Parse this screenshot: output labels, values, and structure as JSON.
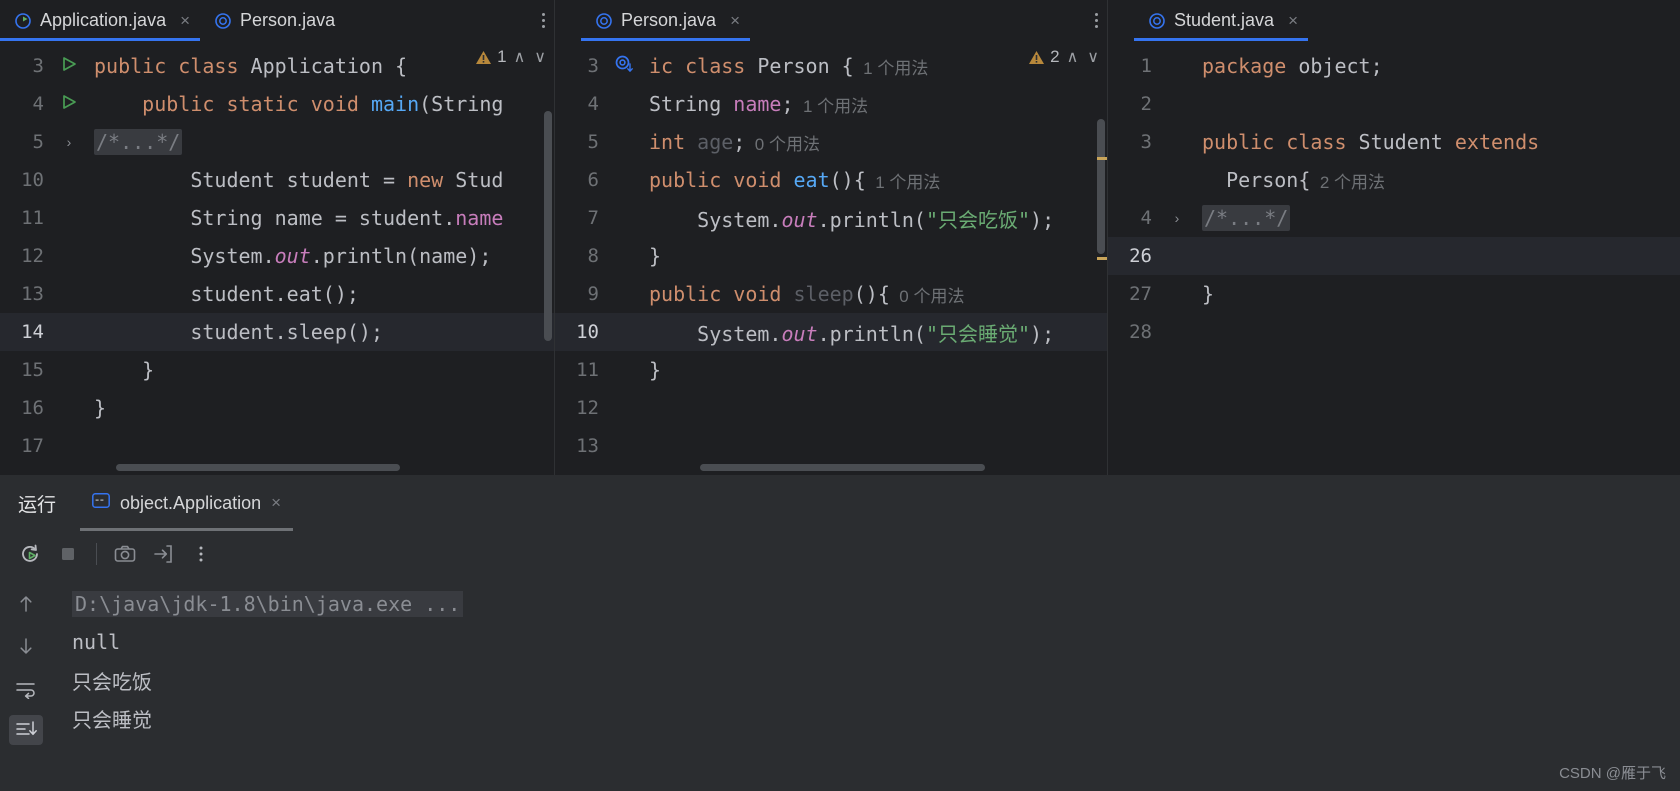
{
  "window": {
    "theme_bg": "#1e1f22",
    "panel_bg": "#2b2d30",
    "accent": "#3574f0"
  },
  "tab_groups": [
    {
      "name": "editor-group-1",
      "tabs": [
        {
          "label": "Application.java",
          "icon": "java-class-run-icon",
          "active": true,
          "close": "×"
        },
        {
          "label": "Person.java",
          "icon": "java-class-icon",
          "active": false,
          "close": ""
        }
      ],
      "overflow_icon": "more-options-icon"
    },
    {
      "name": "editor-group-2",
      "tabs": [
        {
          "label": "Person.java",
          "icon": "java-class-icon",
          "active": true,
          "close": "×"
        }
      ],
      "overflow_icon": "more-options-icon"
    },
    {
      "name": "editor-group-3",
      "tabs": [
        {
          "label": "Student.java",
          "icon": "java-class-icon",
          "active": true,
          "close": "×"
        }
      ],
      "overflow_icon": "more-options-icon"
    }
  ],
  "editor1": {
    "file": "Application.java",
    "inspection": {
      "warning_count": "1",
      "icon": "warning-triangle-icon",
      "up": "∧",
      "down": "∨"
    },
    "lines": [
      {
        "num": "3",
        "gutter": "run-class-icon",
        "current": false,
        "fold": "",
        "tokens": [
          {
            "t": "public ",
            "c": "kw"
          },
          {
            "t": "class ",
            "c": "kw"
          },
          {
            "t": "Application ",
            "c": "cls"
          },
          {
            "t": "{",
            "c": "plain"
          }
        ]
      },
      {
        "num": "4",
        "gutter": "run-method-icon",
        "current": false,
        "fold": "",
        "tokens": [
          {
            "t": "    public ",
            "c": "kw"
          },
          {
            "t": "static ",
            "c": "kw"
          },
          {
            "t": "void ",
            "c": "kw"
          },
          {
            "t": "main",
            "c": "meth"
          },
          {
            "t": "(String",
            "c": "plain"
          }
        ]
      },
      {
        "num": "5",
        "gutter": "",
        "current": false,
        "fold": "›",
        "tokens": [
          {
            "t": "/*...*/",
            "c": "fold"
          }
        ]
      },
      {
        "num": "10",
        "gutter": "",
        "current": false,
        "fold": "",
        "tokens": [
          {
            "t": "        Student student = ",
            "c": "plain"
          },
          {
            "t": "new ",
            "c": "kw"
          },
          {
            "t": "Stud",
            "c": "plain"
          }
        ]
      },
      {
        "num": "11",
        "gutter": "",
        "current": false,
        "fold": "",
        "tokens": [
          {
            "t": "        String name = student.",
            "c": "plain"
          },
          {
            "t": "name",
            "c": "fld"
          }
        ]
      },
      {
        "num": "12",
        "gutter": "",
        "current": false,
        "fold": "",
        "tokens": [
          {
            "t": "        System.",
            "c": "plain"
          },
          {
            "t": "out",
            "c": "stat"
          },
          {
            "t": ".println(name);",
            "c": "plain"
          }
        ]
      },
      {
        "num": "13",
        "gutter": "",
        "current": false,
        "fold": "",
        "tokens": [
          {
            "t": "        student.eat();",
            "c": "plain"
          }
        ]
      },
      {
        "num": "14",
        "gutter": "",
        "current": true,
        "fold": "",
        "tokens": [
          {
            "t": "        student.sleep();",
            "c": "plain"
          }
        ]
      },
      {
        "num": "15",
        "gutter": "",
        "current": false,
        "fold": "",
        "tokens": [
          {
            "t": "    }",
            "c": "plain"
          }
        ]
      },
      {
        "num": "16",
        "gutter": "",
        "current": false,
        "fold": "",
        "tokens": [
          {
            "t": "}",
            "c": "plain"
          }
        ]
      },
      {
        "num": "17",
        "gutter": "",
        "current": false,
        "fold": "",
        "tokens": []
      }
    ]
  },
  "editor2": {
    "file": "Person.java",
    "inspection": {
      "warning_count": "2",
      "icon": "warning-triangle-icon",
      "up": "∧",
      "down": "∨"
    },
    "lines": [
      {
        "num": "3",
        "gutter": "implemented-by-icon",
        "current": false,
        "fold": "",
        "tokens": [
          {
            "t": "ic ",
            "c": "kw"
          },
          {
            "t": "class ",
            "c": "kw"
          },
          {
            "t": "Person ",
            "c": "cls"
          },
          {
            "t": "{",
            "c": "plain"
          }
        ],
        "usage": "1 个用法"
      },
      {
        "num": "4",
        "gutter": "",
        "current": false,
        "fold": "",
        "tokens": [
          {
            "t": "String ",
            "c": "plain"
          },
          {
            "t": "name",
            "c": "fld"
          },
          {
            "t": ";",
            "c": "plain"
          }
        ],
        "usage": "1 个用法"
      },
      {
        "num": "5",
        "gutter": "",
        "current": false,
        "fold": "",
        "tokens": [
          {
            "t": "int ",
            "c": "kw"
          },
          {
            "t": "age",
            "c": "dim"
          },
          {
            "t": ";",
            "c": "plain"
          }
        ],
        "usage": "0 个用法"
      },
      {
        "num": "6",
        "gutter": "",
        "current": false,
        "fold": "",
        "tokens": [
          {
            "t": "public ",
            "c": "kw"
          },
          {
            "t": "void ",
            "c": "kw"
          },
          {
            "t": "eat",
            "c": "meth"
          },
          {
            "t": "(){",
            "c": "plain"
          }
        ],
        "usage": "1 个用法"
      },
      {
        "num": "7",
        "gutter": "",
        "current": false,
        "fold": "",
        "tokens": [
          {
            "t": "    System.",
            "c": "plain"
          },
          {
            "t": "out",
            "c": "stat"
          },
          {
            "t": ".println(",
            "c": "plain"
          },
          {
            "t": "\"只会吃饭\"",
            "c": "str"
          },
          {
            "t": ");",
            "c": "plain"
          }
        ],
        "usage": ""
      },
      {
        "num": "8",
        "gutter": "",
        "current": false,
        "fold": "",
        "tokens": [
          {
            "t": "}",
            "c": "plain"
          }
        ],
        "usage": ""
      },
      {
        "num": "9",
        "gutter": "",
        "current": false,
        "fold": "",
        "tokens": [
          {
            "t": "public ",
            "c": "kw"
          },
          {
            "t": "void ",
            "c": "kw"
          },
          {
            "t": "sleep",
            "c": "dim"
          },
          {
            "t": "(){",
            "c": "plain"
          }
        ],
        "usage": "0 个用法"
      },
      {
        "num": "10",
        "gutter": "",
        "current": true,
        "fold": "",
        "tokens": [
          {
            "t": "    System.",
            "c": "plain"
          },
          {
            "t": "out",
            "c": "stat"
          },
          {
            "t": ".println(",
            "c": "plain"
          },
          {
            "t": "\"只会睡觉\"",
            "c": "str"
          },
          {
            "t": ");",
            "c": "plain"
          }
        ],
        "usage": ""
      },
      {
        "num": "11",
        "gutter": "",
        "current": false,
        "fold": "",
        "tokens": [
          {
            "t": "}",
            "c": "plain"
          }
        ],
        "usage": ""
      },
      {
        "num": "12",
        "gutter": "",
        "current": false,
        "fold": "",
        "tokens": [],
        "usage": ""
      },
      {
        "num": "13",
        "gutter": "",
        "current": false,
        "fold": "",
        "tokens": [],
        "usage": ""
      }
    ]
  },
  "editor3": {
    "file": "Student.java",
    "lines": [
      {
        "num": "1",
        "gutter": "",
        "current": false,
        "fold": "",
        "tokens": [
          {
            "t": "package ",
            "c": "kw"
          },
          {
            "t": "object;",
            "c": "plain"
          }
        ],
        "usage": ""
      },
      {
        "num": "2",
        "gutter": "",
        "current": false,
        "fold": "",
        "tokens": [],
        "usage": ""
      },
      {
        "num": "3",
        "gutter": "",
        "current": false,
        "fold": "",
        "tokens": [
          {
            "t": "public ",
            "c": "kw"
          },
          {
            "t": "class ",
            "c": "kw"
          },
          {
            "t": "Student ",
            "c": "cls"
          },
          {
            "t": "extends",
            "c": "kw"
          }
        ],
        "usage": ""
      },
      {
        "num": "",
        "gutter": "",
        "current": false,
        "fold": "",
        "tokens": [
          {
            "t": "  Person{",
            "c": "plain"
          }
        ],
        "usage": "2 个用法"
      },
      {
        "num": "4",
        "gutter": "",
        "current": false,
        "fold": "›",
        "tokens": [
          {
            "t": "/*...*/",
            "c": "fold"
          }
        ],
        "usage": ""
      },
      {
        "num": "26",
        "gutter": "",
        "current": true,
        "fold": "",
        "tokens": [],
        "usage": ""
      },
      {
        "num": "27",
        "gutter": "",
        "current": false,
        "fold": "",
        "tokens": [
          {
            "t": "}",
            "c": "plain"
          }
        ],
        "usage": ""
      },
      {
        "num": "28",
        "gutter": "",
        "current": false,
        "fold": "",
        "tokens": [],
        "usage": ""
      }
    ]
  },
  "run_panel": {
    "title": "运行",
    "tab": {
      "label": "object.Application",
      "icon": "console-icon",
      "close": "×"
    },
    "toolbar": [
      {
        "name": "rerun-button",
        "icon": "rerun-icon"
      },
      {
        "name": "stop-button",
        "icon": "stop-square-icon"
      },
      {
        "name": "screenshot-button",
        "icon": "camera-icon"
      },
      {
        "name": "export-button",
        "icon": "arrow-into-box-icon"
      },
      {
        "name": "more-options-button",
        "icon": "more-options-icon"
      }
    ],
    "left_rail": [
      {
        "name": "scroll-up-button",
        "icon": "arrow-up-icon",
        "selected": false
      },
      {
        "name": "scroll-down-button",
        "icon": "arrow-down-icon",
        "selected": false
      },
      {
        "name": "soft-wrap-button",
        "icon": "soft-wrap-icon",
        "selected": false
      },
      {
        "name": "scroll-to-end-button",
        "icon": "scroll-to-end-icon",
        "selected": true
      }
    ],
    "console_lines": [
      {
        "text": "D:\\java\\jdk-1.8\\bin\\java.exe ...",
        "highlight": true
      },
      {
        "text": "null",
        "highlight": false
      },
      {
        "text": "只会吃饭",
        "highlight": false
      },
      {
        "text": "只会睡觉",
        "highlight": false
      }
    ]
  },
  "watermark": "CSDN @雁于飞"
}
